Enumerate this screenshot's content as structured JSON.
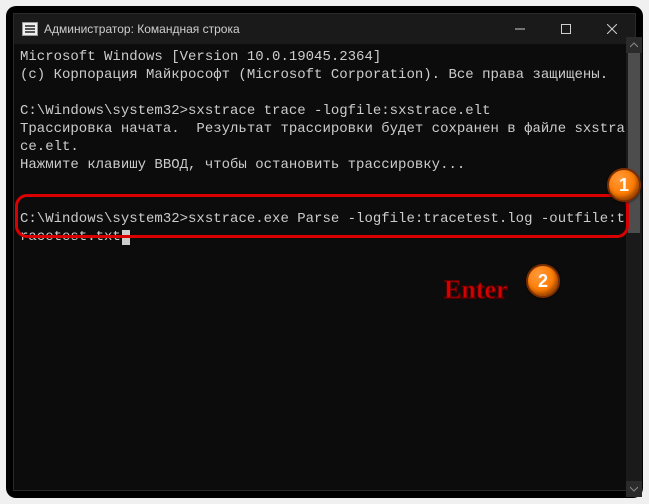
{
  "titlebar": {
    "title": "Администратор: Командная строка"
  },
  "terminal": {
    "line1": "Microsoft Windows [Version 10.0.19045.2364]",
    "line2": "(c) Корпорация Майкрософт (Microsoft Corporation). Все права защищены.",
    "blank1": "",
    "prompt1": "C:\\Windows\\system32>",
    "cmd1": "sxstrace trace -logfile:sxstrace.elt",
    "line3": "Трассировка начата.  Результат трассировки будет сохранен в файле sxstrace.elt.",
    "line4": "Нажмите клавишу ВВОД, чтобы остановить трассировку...",
    "blank2": "",
    "blank3": "",
    "prompt2": "C:\\Windows\\system32>",
    "cmd2": "sxstrace.exe Parse -logfile:tracetest.log -outfile:tracetest.txt"
  },
  "annotations": {
    "badge1": "1",
    "badge2": "2",
    "enter": "Enter"
  }
}
